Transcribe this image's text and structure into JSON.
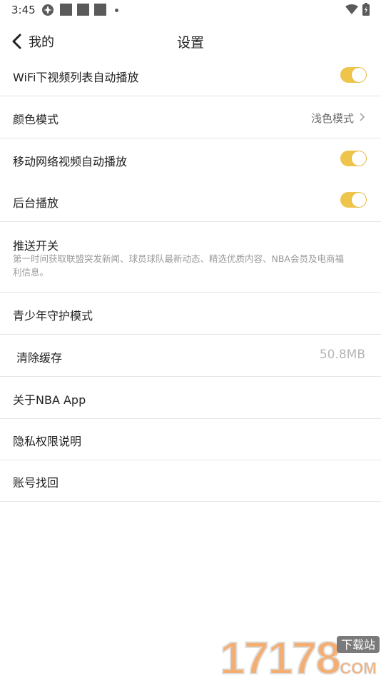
{
  "status_bar": {
    "time": "3:45"
  },
  "header": {
    "back_label": "我的",
    "title": "设置"
  },
  "settings": {
    "wifi_autoplay": {
      "label": "WiFi下视频列表自动播放",
      "enabled": true
    },
    "color_mode": {
      "label": "颜色模式",
      "value": "浅色模式"
    },
    "mobile_autoplay": {
      "label": "移动网络视频自动播放",
      "enabled": true
    },
    "background_play": {
      "label": "后台播放",
      "enabled": true
    },
    "push": {
      "label": "推送开关",
      "description": "第一时间获取联盟突发新闻、球员球队最新动态、精选优质内容、NBA会员及电商福利信息。"
    },
    "youth_mode": {
      "label": "青少年守护模式"
    },
    "clear_cache": {
      "label": "清除缓存",
      "value": "50.8MB"
    },
    "about": {
      "label": "关于NBA App"
    },
    "privacy": {
      "label": "隐私权限说明"
    },
    "account_recovery": {
      "label": "账号找回"
    }
  },
  "watermark": {
    "number": "17178",
    "tag": "下载站",
    "domain": "COM"
  },
  "colors": {
    "toggle_on": "#efc44a",
    "divider": "#e6e6e6"
  }
}
